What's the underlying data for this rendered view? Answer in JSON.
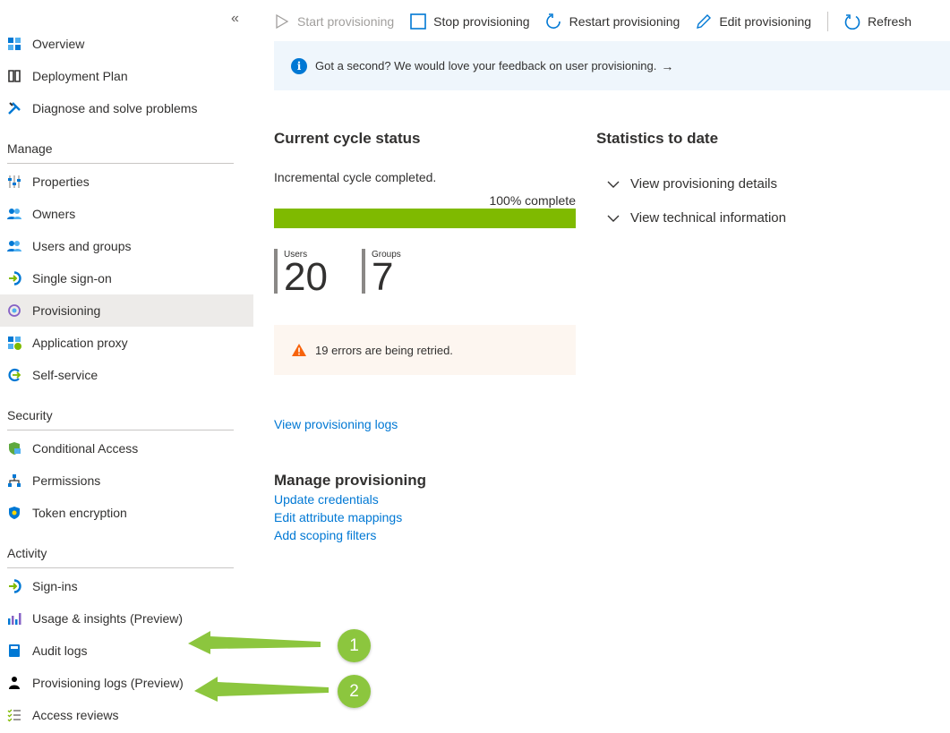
{
  "sidebar": {
    "collapse_glyph": "«",
    "items_top": [
      {
        "label": "Overview",
        "icon": "grid-icon"
      },
      {
        "label": "Deployment Plan",
        "icon": "book-icon"
      },
      {
        "label": "Diagnose and solve problems",
        "icon": "wrench-icon"
      }
    ],
    "sections": {
      "manage": "Manage",
      "security": "Security",
      "activity": "Activity"
    },
    "manage_items": [
      {
        "label": "Properties",
        "icon": "sliders-icon"
      },
      {
        "label": "Owners",
        "icon": "people-icon"
      },
      {
        "label": "Users and groups",
        "icon": "people-icon"
      },
      {
        "label": "Single sign-on",
        "icon": "sign-in-icon"
      },
      {
        "label": "Provisioning",
        "icon": "provisioning-icon",
        "selected": true
      },
      {
        "label": "Application proxy",
        "icon": "app-proxy-icon"
      },
      {
        "label": "Self-service",
        "icon": "self-service-icon"
      }
    ],
    "security_items": [
      {
        "label": "Conditional Access",
        "icon": "shield-green-icon"
      },
      {
        "label": "Permissions",
        "icon": "hierarchy-icon"
      },
      {
        "label": "Token encryption",
        "icon": "shield-blue-icon"
      }
    ],
    "activity_items": [
      {
        "label": "Sign-ins",
        "icon": "sign-in-icon"
      },
      {
        "label": "Usage & insights (Preview)",
        "icon": "bar-chart-icon"
      },
      {
        "label": "Audit logs",
        "icon": "log-book-icon"
      },
      {
        "label": "Provisioning logs (Preview)",
        "icon": "person-icon"
      },
      {
        "label": "Access reviews",
        "icon": "checklist-icon"
      }
    ]
  },
  "toolbar": {
    "start": "Start provisioning",
    "stop": "Stop provisioning",
    "restart": "Restart provisioning",
    "edit": "Edit provisioning",
    "refresh": "Refresh"
  },
  "banner": {
    "text": "Got a second? We would love your feedback on user provisioning.",
    "arrow": "→"
  },
  "current_cycle": {
    "title": "Current cycle status",
    "status": "Incremental cycle completed.",
    "progress_label": "100% complete",
    "progress_percent": 100,
    "users_label": "Users",
    "users_count": "20",
    "groups_label": "Groups",
    "groups_count": "7",
    "warning": "19 errors are being retried."
  },
  "statistics": {
    "title": "Statistics to date",
    "details": "View provisioning details",
    "technical": "View technical information"
  },
  "links": {
    "view_logs": "View provisioning logs"
  },
  "manage_provisioning": {
    "title": "Manage provisioning",
    "update_credentials": "Update credentials",
    "edit_mappings": "Edit attribute mappings",
    "add_filters": "Add scoping filters"
  },
  "annotations": [
    {
      "number": "1"
    },
    {
      "number": "2"
    }
  ],
  "colors": {
    "accent": "#0078d4",
    "progress": "#7fba00",
    "callout": "#8cc63e",
    "warning": "#f7630c"
  }
}
